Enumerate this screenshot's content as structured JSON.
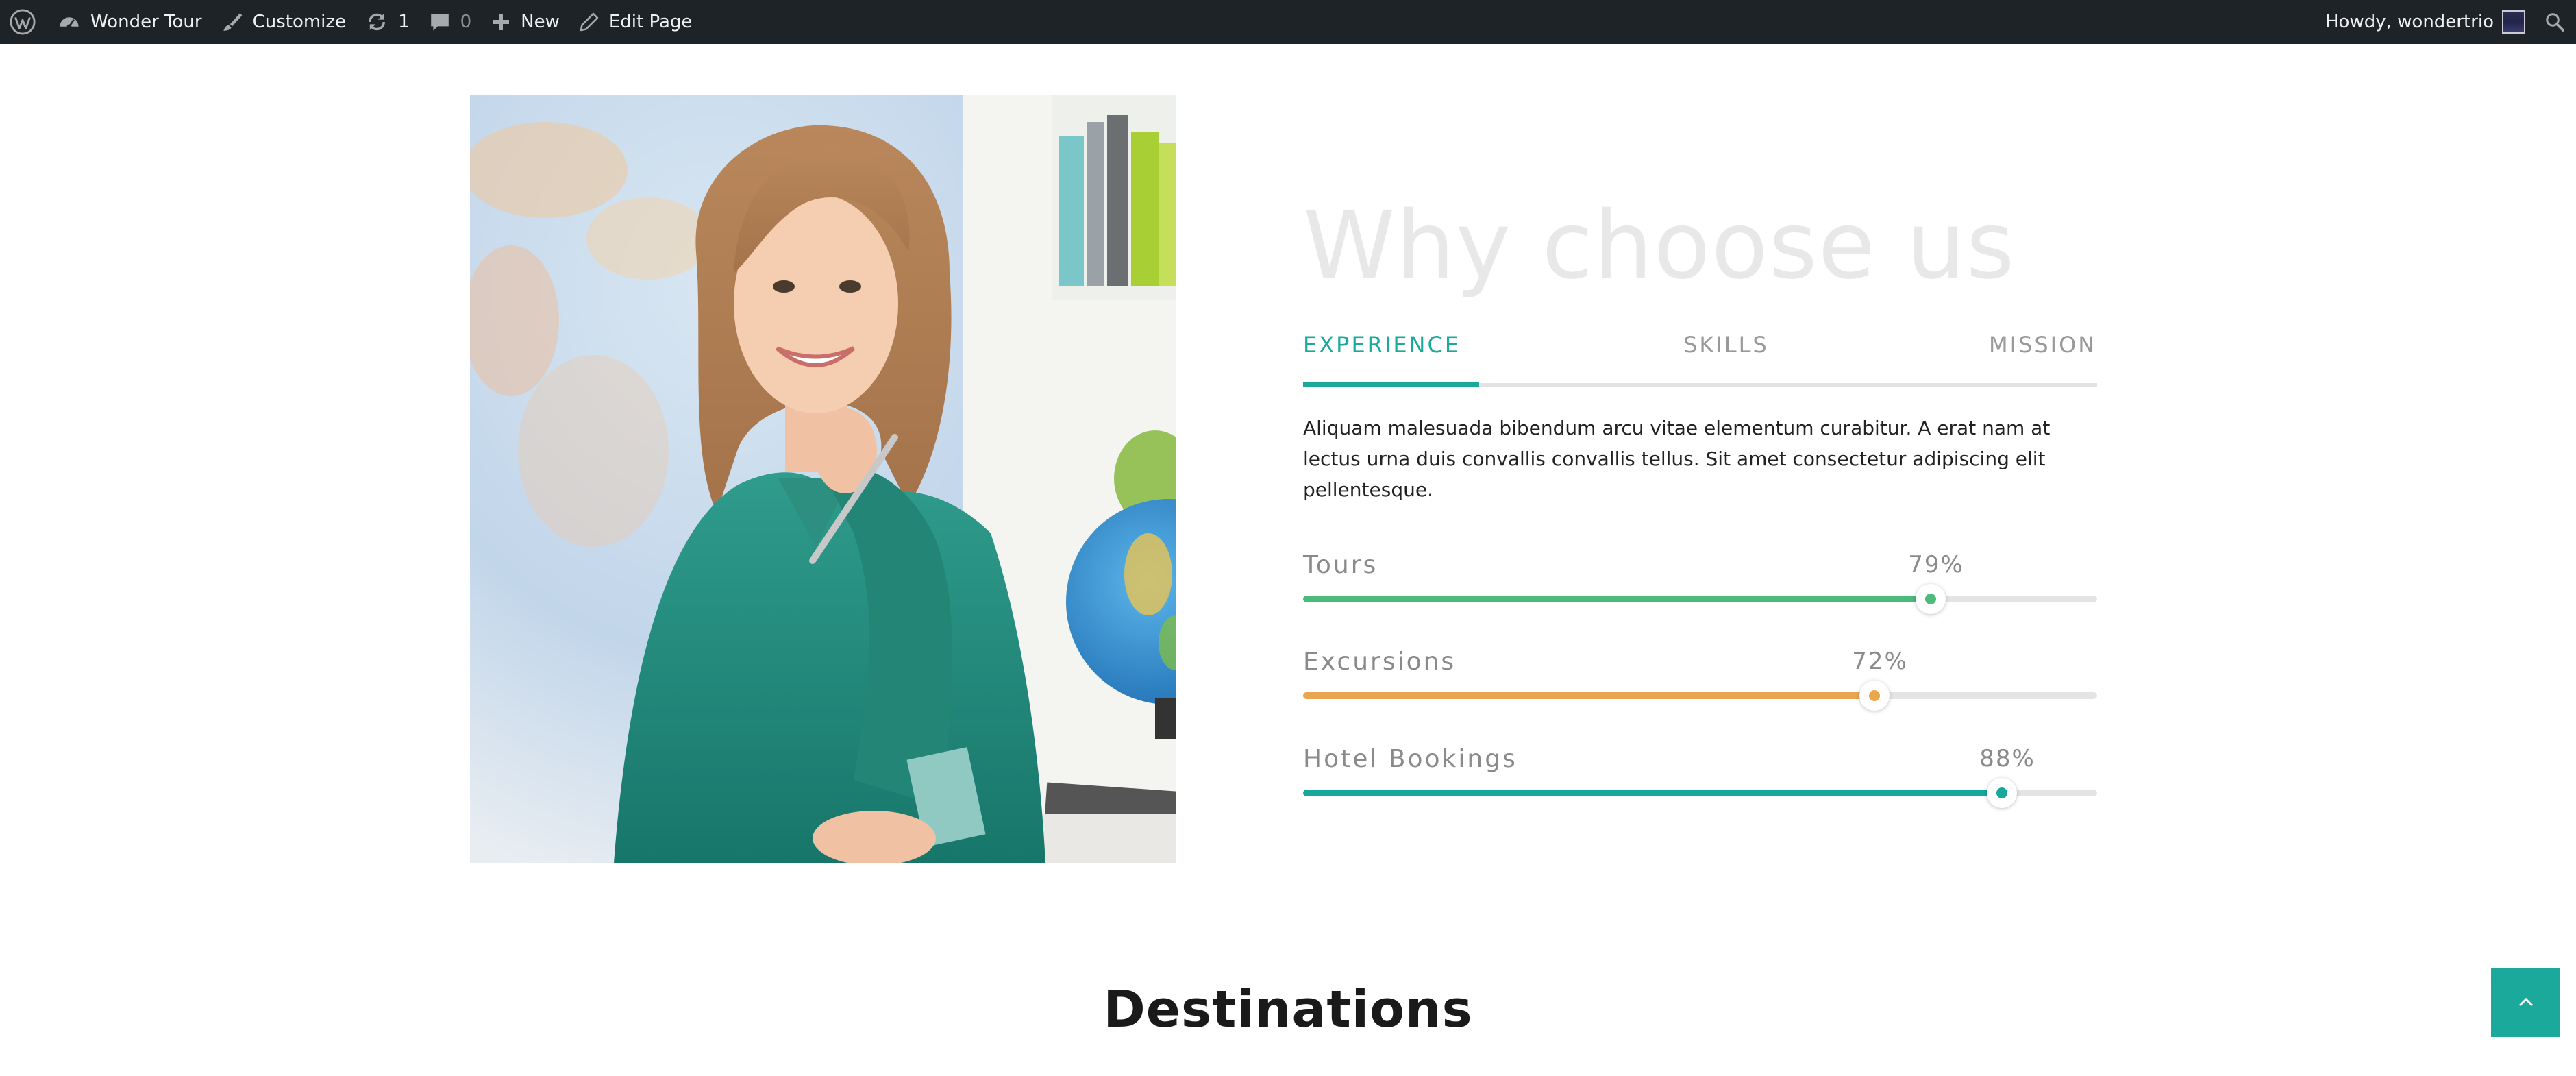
{
  "adminbar": {
    "site_name": "Wonder Tour",
    "customize": "Customize",
    "updates_count": "1",
    "comments_count": "0",
    "new_label": "New",
    "edit_page": "Edit Page",
    "howdy": "Howdy, wondertrio"
  },
  "section": {
    "heading": "Why choose us",
    "tabs": [
      {
        "label": "EXPERIENCE",
        "active": true
      },
      {
        "label": "SKILLS",
        "active": false
      },
      {
        "label": "MISSION",
        "active": false
      }
    ],
    "description": "Aliquam malesuada bibendum arcu vitae elementum curabitur. A erat nam at lectus urna duis convallis convallis tellus. Sit amet consectetur adipiscing elit pellentesque.",
    "skills": [
      {
        "label": "Tours",
        "value_text": "79%",
        "percent": 79,
        "color": "#4cba7a"
      },
      {
        "label": "Excursions",
        "value_text": "72%",
        "percent": 72,
        "color": "#eaa54f"
      },
      {
        "label": "Hotel Bookings",
        "value_text": "88%",
        "percent": 88,
        "color": "#16a99b"
      }
    ]
  },
  "destinations": {
    "heading": "Destinations"
  },
  "colors": {
    "accent": "#1aa99b",
    "admin_bar": "#1d2327"
  },
  "icons": {
    "wp_logo": "wordpress-logo-icon",
    "dashboard": "dashboard-icon",
    "customize": "paintbrush-icon",
    "updates": "updates-icon",
    "comments": "comment-bubble-icon",
    "new": "plus-icon",
    "edit": "pencil-icon",
    "search": "search-icon",
    "back_to_top": "chevron-up-icon"
  }
}
